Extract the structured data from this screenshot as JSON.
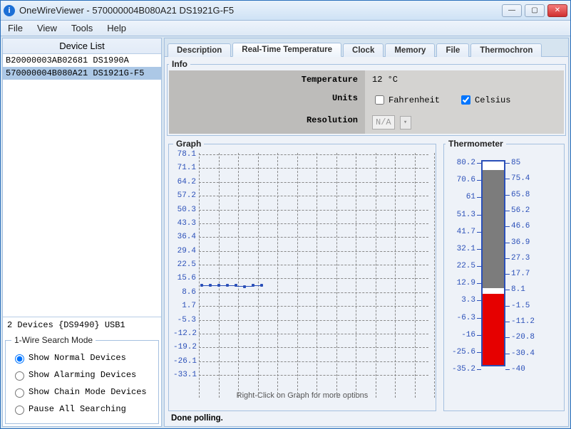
{
  "window": {
    "title": "OneWireViewer - 570000004B080A21 DS1921G-F5"
  },
  "menu": {
    "items": [
      "File",
      "View",
      "Tools",
      "Help"
    ]
  },
  "sidebar": {
    "header": "Device List",
    "devices": [
      {
        "text": "B20000003AB02681 DS1990A"
      },
      {
        "text": "570000004B080A21 DS1921G-F5"
      }
    ],
    "status": "2 Devices  {DS9490} USB1",
    "search_legend": "1-Wire Search Mode",
    "search_options": [
      "Show Normal Devices",
      "Show Alarming Devices",
      "Show Chain Mode Devices",
      "Pause All Searching"
    ]
  },
  "tabs": [
    "Description",
    "Real-Time Temperature",
    "Clock",
    "Memory",
    "File",
    "Thermochron"
  ],
  "info": {
    "legend": "Info",
    "temperature_label": "Temperature",
    "temperature_value": "12 °C",
    "units_label": "Units",
    "fahrenheit": "Fahrenheit",
    "celsius": "Celsius",
    "resolution_label": "Resolution",
    "resolution_value": "N/A"
  },
  "graph": {
    "legend": "Graph",
    "hint": "Right-Click on Graph for more options",
    "y_ticks": [
      "78.1",
      "71.1",
      "64.2",
      "57.2",
      "50.3",
      "43.3",
      "36.4",
      "29.4",
      "22.5",
      "15.6",
      "8.6",
      "1.7",
      "-5.3",
      "-12.2",
      "-19.2",
      "-26.1",
      "-33.1"
    ]
  },
  "therm": {
    "legend": "Thermometer",
    "left_ticks": [
      "80.2",
      "70.6",
      "61",
      "51.3",
      "41.7",
      "32.1",
      "22.5",
      "12.9",
      "3.3",
      "-6.3",
      "-16",
      "-25.6",
      "-35.2"
    ],
    "right_ticks": [
      "85",
      "75.4",
      "65.8",
      "56.2",
      "46.6",
      "36.9",
      "27.3",
      "17.7",
      "8.1",
      "-1.5",
      "-11.2",
      "-20.8",
      "-30.4",
      "-40"
    ]
  },
  "status": "Done polling.",
  "chart_data": {
    "type": "line",
    "title": "Real-Time Temperature",
    "ylabel": "°C",
    "ylim": [
      -33.1,
      78.1
    ],
    "x": [
      0,
      1,
      2,
      3,
      4,
      5,
      6,
      7
    ],
    "values": [
      12,
      12,
      12,
      12,
      12,
      11.5,
      12,
      12
    ],
    "thermometer": {
      "current_c": 12,
      "bar_range_c": [
        -40,
        85
      ]
    }
  }
}
